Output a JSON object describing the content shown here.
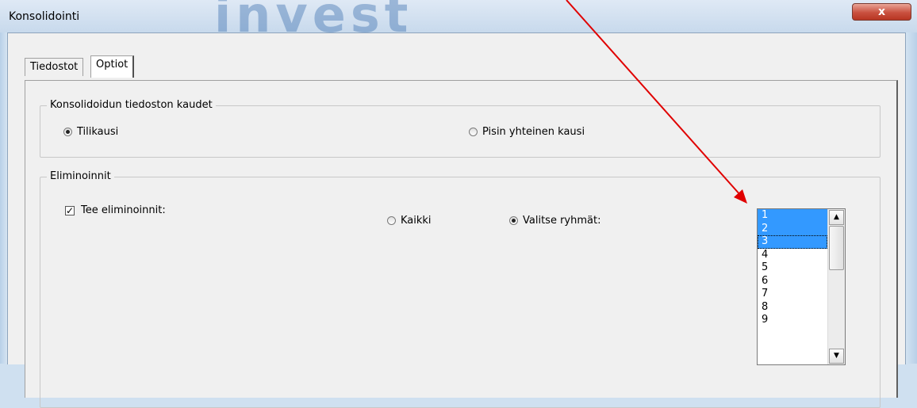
{
  "window": {
    "title": "Konsolidointi",
    "watermark": "invest",
    "close_label": "x"
  },
  "tabs": [
    {
      "label": "Tiedostot",
      "active": false
    },
    {
      "label": "Optiot",
      "active": true
    }
  ],
  "periods_group": {
    "label": "Konsolidoidun tiedoston kaudet",
    "options": [
      {
        "label": "Tilikausi",
        "checked": true
      },
      {
        "label": "Pisin yhteinen kausi",
        "checked": false
      }
    ]
  },
  "eliminations_group": {
    "label": "Eliminoinnit",
    "checkbox": {
      "label": "Tee eliminoinnit:",
      "checked": true,
      "mark": "✓"
    },
    "options": [
      {
        "label": "Kaikki",
        "checked": false
      },
      {
        "label": "Valitse ryhmät:",
        "checked": true
      }
    ]
  },
  "group_list": {
    "items": [
      "1",
      "2",
      "3",
      "4",
      "5",
      "6",
      "7",
      "8",
      "9"
    ],
    "selected": [
      "1",
      "2",
      "3"
    ],
    "focused": "3"
  },
  "colors": {
    "selection": "#3399ff",
    "annotation_arrow": "#e00000",
    "close_button": "#c9503f"
  }
}
